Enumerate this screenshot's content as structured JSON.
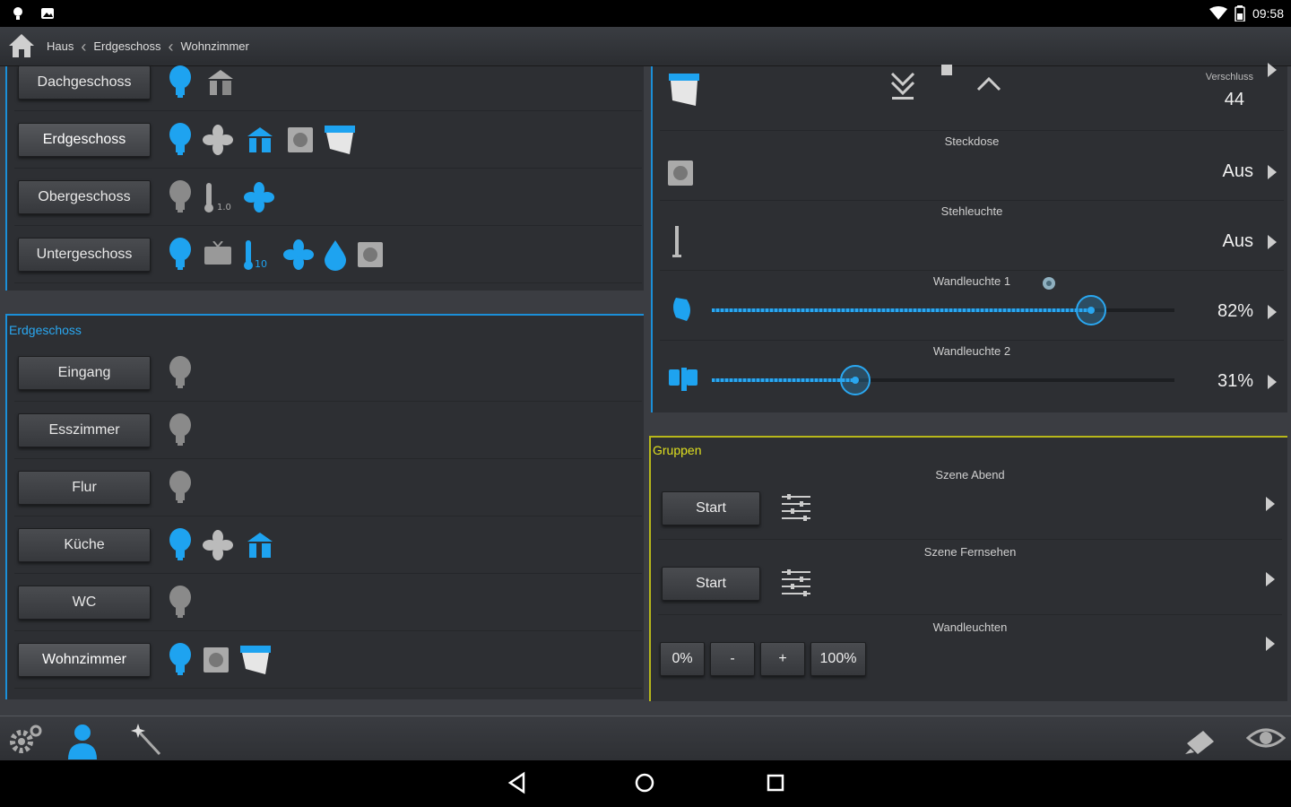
{
  "status": {
    "time": "09:58"
  },
  "breadcrumb": {
    "home_icon": "home-icon",
    "items": [
      "Haus",
      "Erdgeschoss",
      "Wohnzimmer"
    ]
  },
  "floors": [
    {
      "label": "Dachgeschoss",
      "active": false
    },
    {
      "label": "Erdgeschoss",
      "active": true
    },
    {
      "label": "Obergeschoss",
      "active": false
    },
    {
      "label": "Untergeschoss",
      "active": false
    }
  ],
  "rooms_section": {
    "title": "Erdgeschoss"
  },
  "rooms": [
    {
      "label": "Eingang",
      "active": false
    },
    {
      "label": "Esszimmer",
      "active": false
    },
    {
      "label": "Flur",
      "active": false
    },
    {
      "label": "Küche",
      "active": false
    },
    {
      "label": "WC",
      "active": false
    },
    {
      "label": "Wohnzimmer",
      "active": true
    }
  ],
  "devices": {
    "shutter": {
      "label": "Verschluss",
      "value": "44"
    },
    "socket": {
      "label": "Steckdose",
      "value": "Aus"
    },
    "floorlamp": {
      "label": "Stehleuchte",
      "value": "Aus"
    },
    "wall1": {
      "label": "Wandleuchte 1",
      "value": "82%",
      "level": 0.82
    },
    "wall2": {
      "label": "Wandleuchte 2",
      "value": "31%",
      "level": 0.31
    }
  },
  "groups": {
    "title": "Gruppen",
    "scene1": {
      "label": "Szene Abend",
      "button": "Start"
    },
    "scene2": {
      "label": "Szene Fernsehen",
      "button": "Start"
    },
    "wall": {
      "label": "Wandleuchten",
      "b0": "0%",
      "bminus": "-",
      "bplus": "+",
      "b100": "100%"
    }
  },
  "colors": {
    "accent": "#2aa7f0",
    "group_accent": "#e0e020",
    "bg": "#2d2f33"
  }
}
